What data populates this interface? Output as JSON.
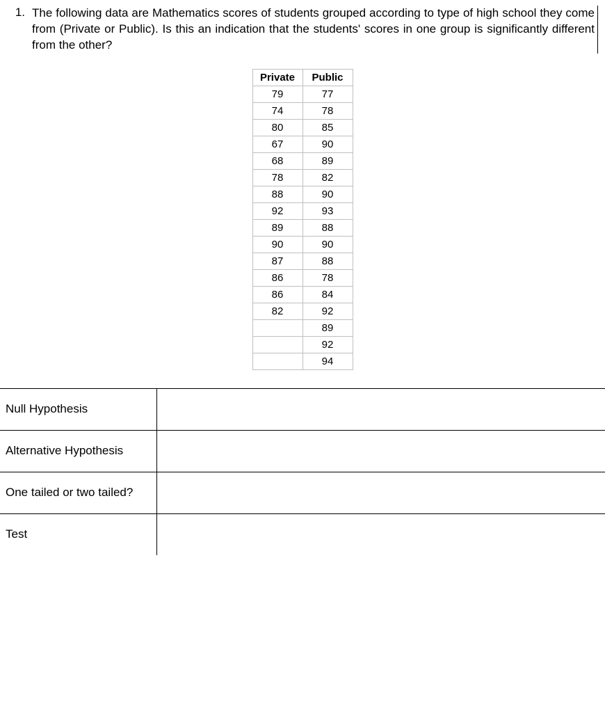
{
  "question": {
    "number": "1.",
    "text": "The following data are Mathematics scores of students grouped according to type of high school they come from (Private or Public). Is this an indication that the students' scores in one group is significantly different from the other?"
  },
  "chart_data": {
    "type": "table",
    "columns": [
      "Private",
      "Public"
    ],
    "rows": [
      [
        "79",
        "77"
      ],
      [
        "74",
        "78"
      ],
      [
        "80",
        "85"
      ],
      [
        "67",
        "90"
      ],
      [
        "68",
        "89"
      ],
      [
        "78",
        "82"
      ],
      [
        "88",
        "90"
      ],
      [
        "92",
        "93"
      ],
      [
        "89",
        "88"
      ],
      [
        "90",
        "90"
      ],
      [
        "87",
        "88"
      ],
      [
        "86",
        "78"
      ],
      [
        "86",
        "84"
      ],
      [
        "82",
        "92"
      ],
      [
        "",
        "89"
      ],
      [
        "",
        "92"
      ],
      [
        "",
        "94"
      ]
    ]
  },
  "answers": [
    {
      "label": "Null Hypothesis",
      "value": ""
    },
    {
      "label": "Alternative Hypothesis",
      "value": ""
    },
    {
      "label": "One tailed or two tailed?",
      "value": ""
    },
    {
      "label": "Test",
      "value": ""
    }
  ]
}
